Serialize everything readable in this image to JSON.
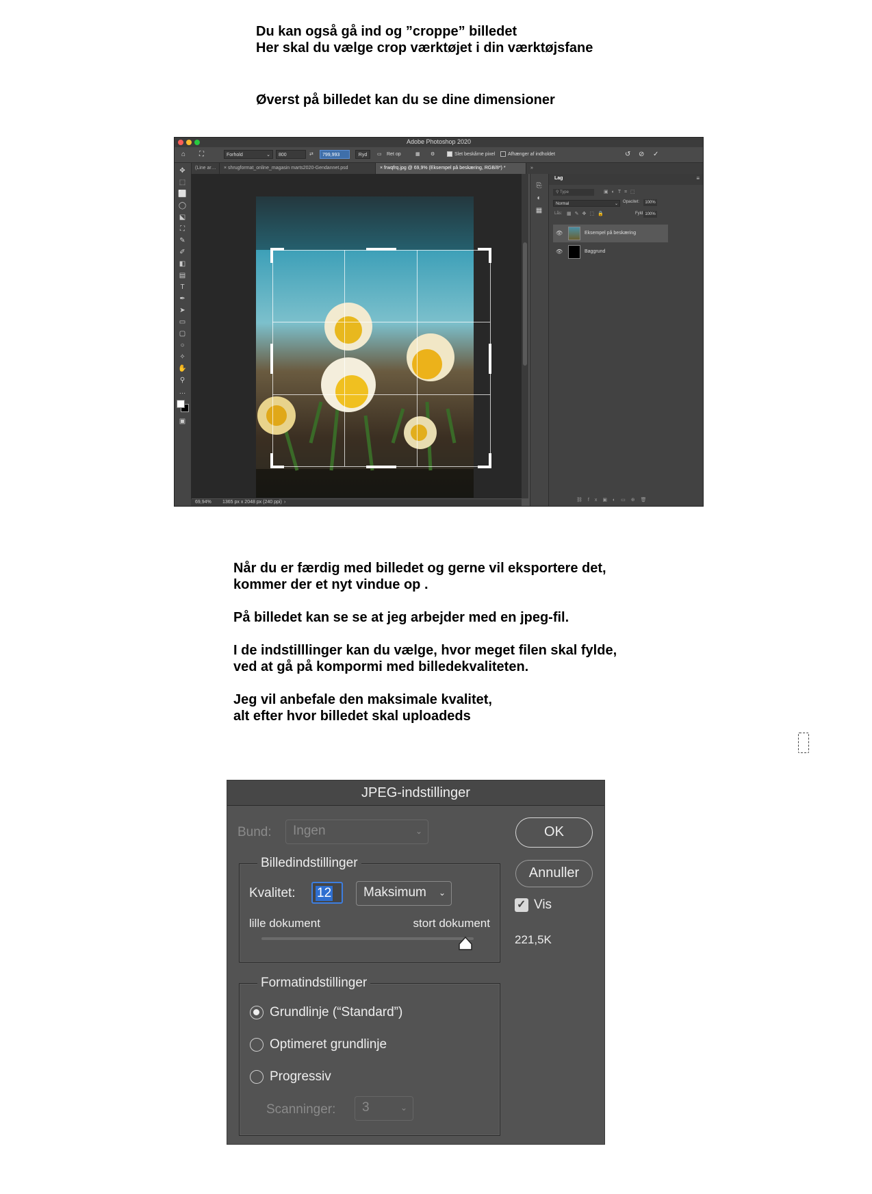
{
  "instructions_top": {
    "line1": "Du kan også gå ind og ”croppe” billedet",
    "line2": "Her skal du vælge crop værktøjet i din værktøjsfane",
    "line3": "Øverst på billedet kan du se dine dimensioner"
  },
  "photoshop": {
    "window_title": "Adobe Photoshop 2020",
    "options_bar": {
      "ratio_select": "Forhold",
      "width_value": "800",
      "height_value": "799,993",
      "clear_label": "Ryd",
      "straighten_label": "Ret op",
      "delete_cropped_label": "Slet beskårne pixel",
      "content_aware_label": "Afhænger af indholdet"
    },
    "tabs": [
      "(Line ar…",
      "shrugformat_online_magasin marts2020-Gendannet.psd",
      "frwqfrq.jpg @ 69,9% (Eksempel på beskæring, RGB/8*) *"
    ],
    "status": {
      "zoom": "69,94%",
      "dimensions": "1365 px x 2048 px (240 ppi)"
    },
    "layers_panel": {
      "title": "Lag",
      "search_placeholder": "Type",
      "blend_mode": "Normal",
      "opacity_label": "Opacitet:",
      "opacity_value": "100%",
      "lock_label": "Lås:",
      "fill_label": "Fyld:",
      "fill_value": "100%",
      "layers": [
        {
          "name": "Eksempel på beskæring"
        },
        {
          "name": "Baggrund"
        }
      ]
    }
  },
  "instructions_middle": {
    "p1_line1": "Når du er færdig med billedet og gerne vil eksportere det,",
    "p1_line2": "kommer der et nyt vindue op .",
    "p2": "På billedet kan se se at jeg arbejder med en jpeg-fil.",
    "p3_line1": "I de indstilllinger kan du vælge, hvor meget filen skal fylde,",
    "p3_line2": "ved at gå på kompormi med billedekvaliteten.",
    "p4_line1": "Jeg vil anbefale den maksimale kvalitet,",
    "p4_line2": "alt efter hvor billedet skal uploadeds"
  },
  "jpeg_dialog": {
    "title": "JPEG-indstillinger",
    "matte_label": "Bund:",
    "matte_value": "Ingen",
    "ok_label": "OK",
    "cancel_label": "Annuller",
    "image_options": {
      "legend": "Billedindstillinger",
      "quality_label": "Kvalitet:",
      "quality_value": "12",
      "quality_preset": "Maksimum",
      "small_file_label": "lille dokument",
      "large_file_label": "stort dokument",
      "slider_position": 0.96
    },
    "preview_label": "Vis",
    "preview_checked": true,
    "file_size": "221,5K",
    "format_options": {
      "legend": "Formatindstillinger",
      "baseline_standard": "Grundlinje (“Standard”)",
      "baseline_optimized": "Optimeret grundlinje",
      "progressive": "Progressiv",
      "scans_label": "Scanninger:",
      "scans_value": "3",
      "selected": "baseline_standard"
    }
  }
}
